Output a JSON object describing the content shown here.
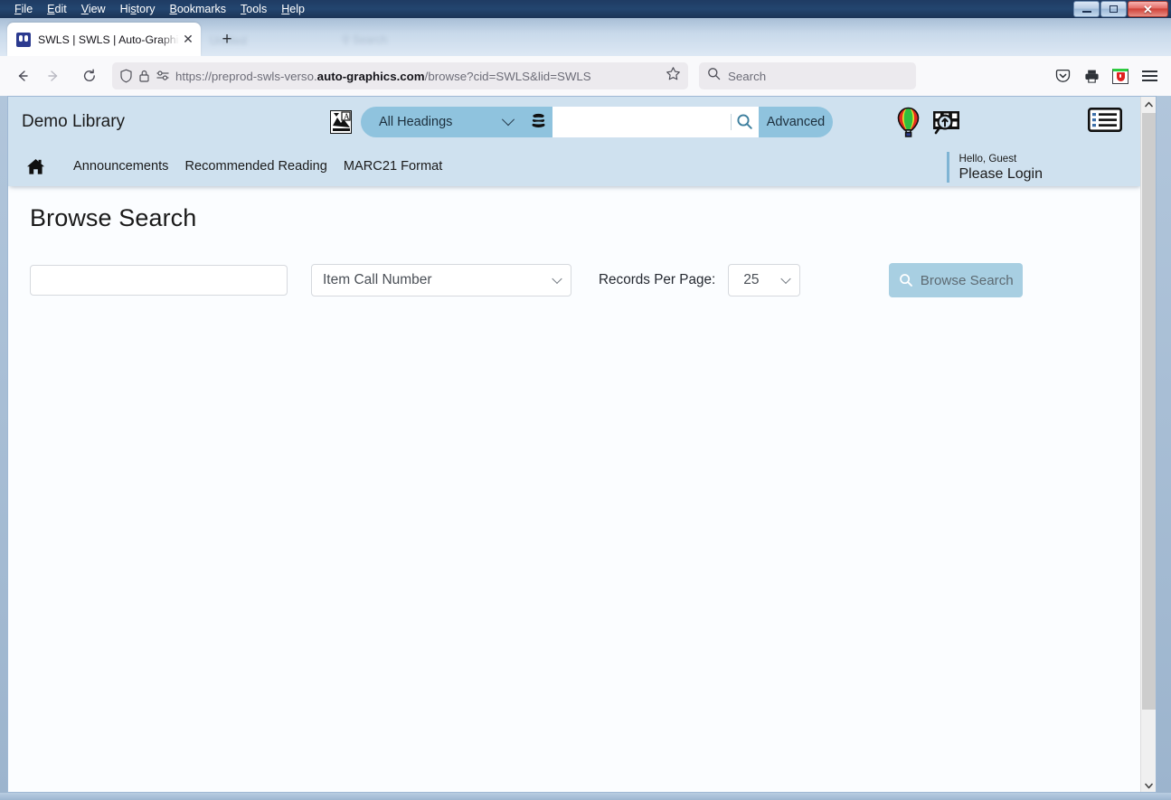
{
  "browser": {
    "menus": [
      "File",
      "Edit",
      "View",
      "History",
      "Bookmarks",
      "Tools",
      "Help"
    ],
    "window_controls": {
      "minimize": "–",
      "maximize": "□",
      "close": "✕"
    },
    "tab": {
      "title": "SWLS | SWLS | Auto-Graphics In",
      "close_label": "✕",
      "new_tab_label": "+"
    },
    "nav": {
      "back_label": "←",
      "forward_label": "→",
      "reload_label": "↻"
    },
    "url": {
      "prefix": "https://preprod-swls-verso.",
      "domain": "auto-graphics.com",
      "suffix": "/browse?cid=SWLS&lid=SWLS",
      "full": "https://preprod-swls-verso.auto-graphics.com/browse?cid=SWLS&lid=SWLS"
    },
    "search": {
      "placeholder": "Search"
    },
    "toolbar_icons": [
      "pocket-icon",
      "printer-icon",
      "extension-icon",
      "menu-icon"
    ]
  },
  "site": {
    "brand": "Demo Library",
    "header": {
      "headings_select": "All Headings",
      "search_value": "",
      "advanced_label": "Advanced",
      "icons": [
        "balloon-icon",
        "film-search-icon",
        "list-view-icon"
      ]
    },
    "nav_links": [
      "Announcements",
      "Recommended Reading",
      "MARC21 Format"
    ],
    "account": {
      "greeting": "Hello, Guest",
      "login": "Please Login"
    }
  },
  "main": {
    "title": "Browse Search",
    "term_input": {
      "value": "",
      "placeholder": ""
    },
    "index_select": "Item Call Number",
    "records_label": "Records Per Page:",
    "records_value": "25",
    "browse_button": "Browse Search"
  },
  "colors": {
    "header_band": "#cfe1ef",
    "accent": "#8fc3de",
    "button": "#a8cfe2",
    "page_bg": "#fbfdff"
  }
}
